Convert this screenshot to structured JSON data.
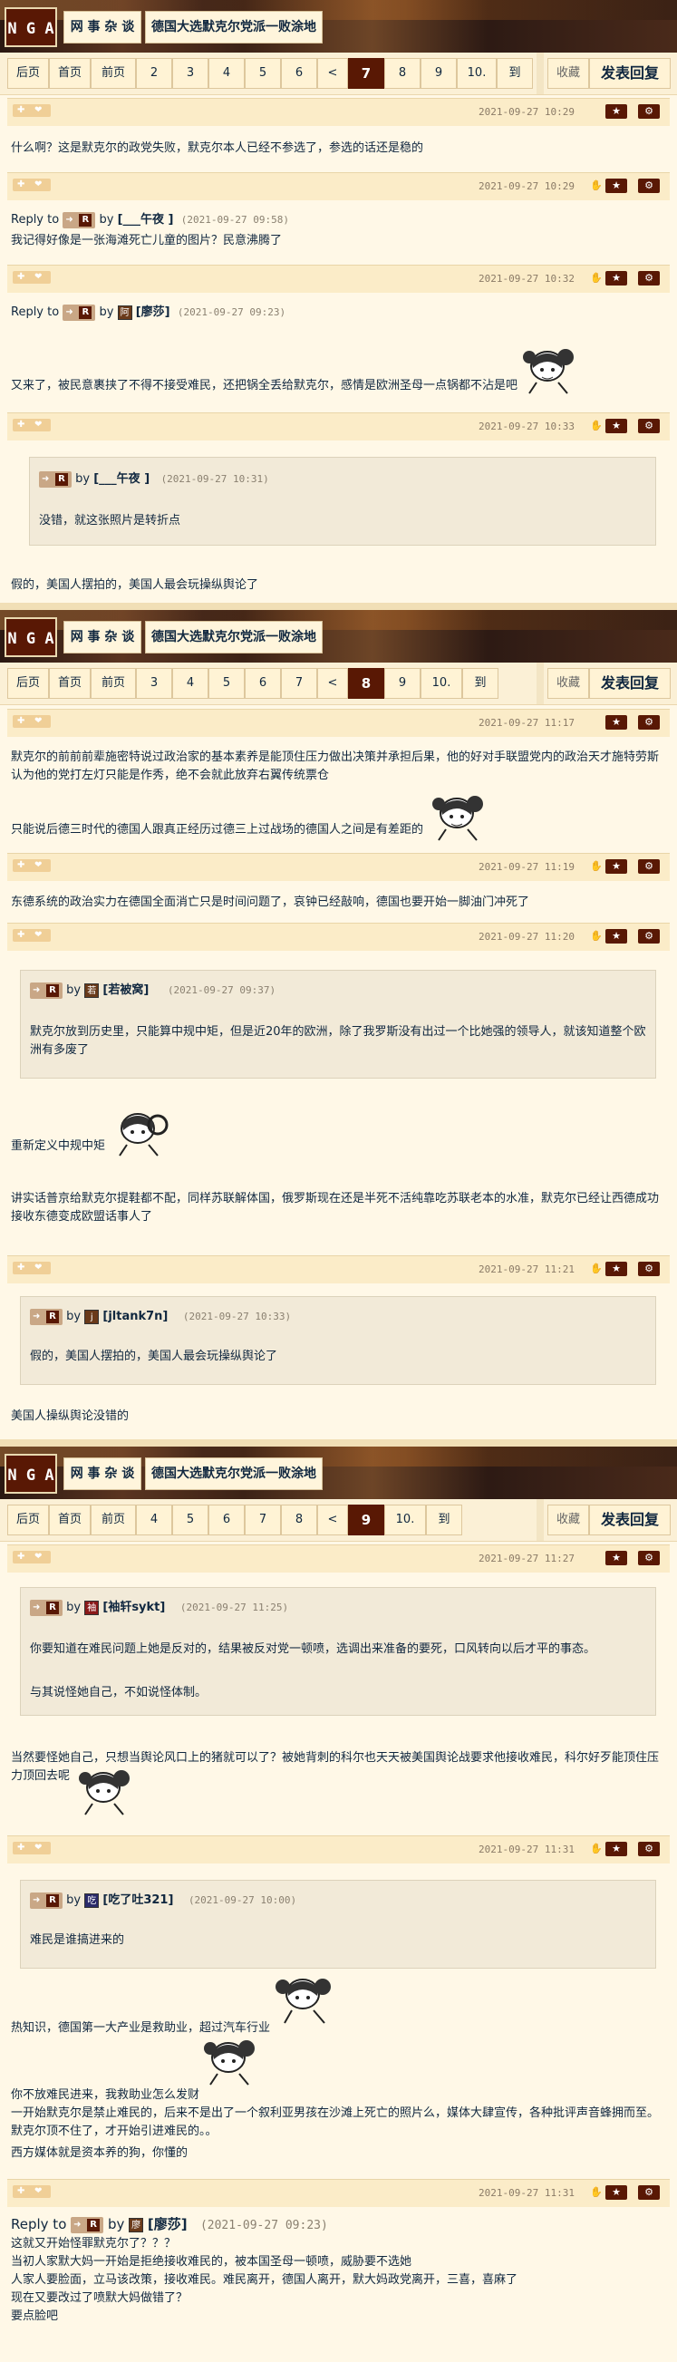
{
  "panels": [
    {
      "logo": "N G A",
      "forum": "网 事 杂 谈",
      "thread": "德国大选默克尔党派一败涂地",
      "nav": {
        "pages": [
          "后页",
          "首页",
          "前页",
          "2",
          "3",
          "4",
          "5",
          "6",
          "<",
          "7",
          "8",
          "9",
          "10.",
          "到"
        ],
        "current": "7",
        "fav": "收藏",
        "reply": "发表回复"
      },
      "posts": [
        {
          "time": "2021-09-27 10:29",
          "text": "什么啊？这是默克尔的政党失败，默克尔本人已经不参选了，参选的话还是稳的"
        },
        {
          "time": "2021-09-27 10:29",
          "reply_prefix": "Reply to",
          "by": "by",
          "user": "[___午夜 ]",
          "date": "(2021-09-27 09:58)",
          "text": "我记得好像是一张海滩死亡儿童的图片？民意沸腾了"
        },
        {
          "time": "2021-09-27 10:32",
          "reply_prefix": "Reply to",
          "by": "by",
          "avatar": "阿",
          "user": "[廖莎]",
          "date": "(2021-09-27 09:23)",
          "text": "又来了，被民意裹挟了不得不接受难民，还把锅全丢给默克尔，感情是欧洲圣母一点锅都不沾是吧"
        },
        {
          "time": "2021-09-27 10:33",
          "by": "by",
          "user": "[___午夜 ]",
          "date": "(2021-09-27 10:31)",
          "quote": "没错，就这张照片是转折点",
          "text": "假的，美国人摆拍的，美国人最会玩操纵舆论了"
        }
      ]
    },
    {
      "logo": "N G A",
      "forum": "网 事 杂 谈",
      "thread": "德国大选默克尔党派一败涂地",
      "nav": {
        "pages": [
          "后页",
          "首页",
          "前页",
          "3",
          "4",
          "5",
          "6",
          "7",
          "<",
          "8",
          "9",
          "10.",
          "到"
        ],
        "current": "8",
        "fav": "收藏",
        "reply": "发表回复"
      },
      "posts": [
        {
          "time": "2021-09-27 11:17",
          "text": "默克尔的前前前辈施密特说过政治家的基本素养是能顶住压力做出决策并承担后果，他的好对手联盟党内的政治天才施特劳斯认为他的党打左灯只能是作秀，绝不会就此放弃右翼传统票仓",
          "text2": "只能说后德三时代的德国人跟真正经历过德三上过战场的德国人之间是有差距的"
        },
        {
          "time": "2021-09-27 11:19",
          "text": "东德系统的政治实力在德国全面消亡只是时间问题了，哀钟已经敲响，德国也要开始一脚油门冲死了"
        },
        {
          "time": "2021-09-27 11:20",
          "by": "by",
          "avatar": "若",
          "user": "[若被窝]",
          "date": "(2021-09-27 09:37)",
          "quote": "默克尔放到历史里，只能算中规中矩，但是近20年的欧洲，除了我罗斯没有出过一个比她强的领导人，就该知道整个欧洲有多废了",
          "text": "重新定义中规中矩",
          "text2": "讲实话普京给默克尔提鞋都不配，同样苏联解体国，俄罗斯现在还是半死不活纯靠吃苏联老本的水准，默克尔已经让西德成功接收东德变成欧盟话事人了"
        },
        {
          "time": "2021-09-27 11:21",
          "by": "by",
          "avatar": "j",
          "user": "[jltank7n]",
          "date": "(2021-09-27 10:33)",
          "quote": "假的，美国人摆拍的，美国人最会玩操纵舆论了",
          "text": "美国人操纵舆论没错的"
        }
      ]
    },
    {
      "logo": "N G A",
      "forum": "网 事 杂 谈",
      "thread": "德国大选默克尔党派一败涂地",
      "nav": {
        "pages": [
          "后页",
          "首页",
          "前页",
          "4",
          "5",
          "6",
          "7",
          "8",
          "<",
          "9",
          "10.",
          "到"
        ],
        "current": "9",
        "fav": "收藏",
        "reply": "发表回复"
      },
      "posts": [
        {
          "time": "2021-09-27 11:27",
          "by": "by",
          "avatar": "袖",
          "user": "[袖轩sykt]",
          "date": "(2021-09-27 11:25)",
          "quote": "你要知道在难民问题上她是反对的，结果被反对党一顿喷，选调出来准备的要死，口风转向以后才平的事态。",
          "quote2": "与其说怪她自己，不如说怪体制。",
          "text": "当然要怪她自己，只想当舆论风口上的猪就可以了？被她背刺的科尔也天天被美国舆论战要求他接收难民，科尔好歹能顶住压力顶回去呢"
        },
        {
          "time": "2021-09-27 11:31",
          "by": "by",
          "avatar": "吃",
          "user": "[吃了吐321]",
          "date": "(2021-09-27 10:00)",
          "quote": "难民是谁搞进来的",
          "text": "热知识，德国第一大产业是救助业，超过汽车行业",
          "text2": "你不放难民进来，我救助业怎么发财",
          "text3": "一开始默克尔是禁止难民的，后来不是出了一个叙利亚男孩在沙滩上死亡的照片么，媒体大肆宣传，各种批评声音蜂拥而至。默克尔顶不住了，才开始引进难民的。。",
          "text4": "西方媒体就是资本养的狗，你懂的"
        },
        {
          "time": "2021-09-27 11:31",
          "reply_prefix": "Reply to",
          "by": "by",
          "avatar": "廖",
          "user": "[廖莎]",
          "date": "(2021-09-27 09:23)",
          "text": "这就又开始怪罪默克尔了？？？",
          "text2": "当初人家默大妈一开始是拒绝接收难民的，被本国圣母一顿喷，威胁要不选她",
          "text3": "人家人要脸面，立马该改策，接收难民。难民离开，德国人离开，默大妈政党离开，三喜，喜麻了",
          "text4": "现在又要改过了喷默大妈做错了？",
          "text5": "要点脸吧"
        }
      ]
    }
  ],
  "icons": {
    "thumb": "thumb-icon",
    "star": "star-icon",
    "gear": "gear-icon",
    "hand": "hand-icon"
  },
  "colors": {
    "accent": "#591804",
    "bg": "#fff8e7",
    "meta": "#fbecc8"
  }
}
